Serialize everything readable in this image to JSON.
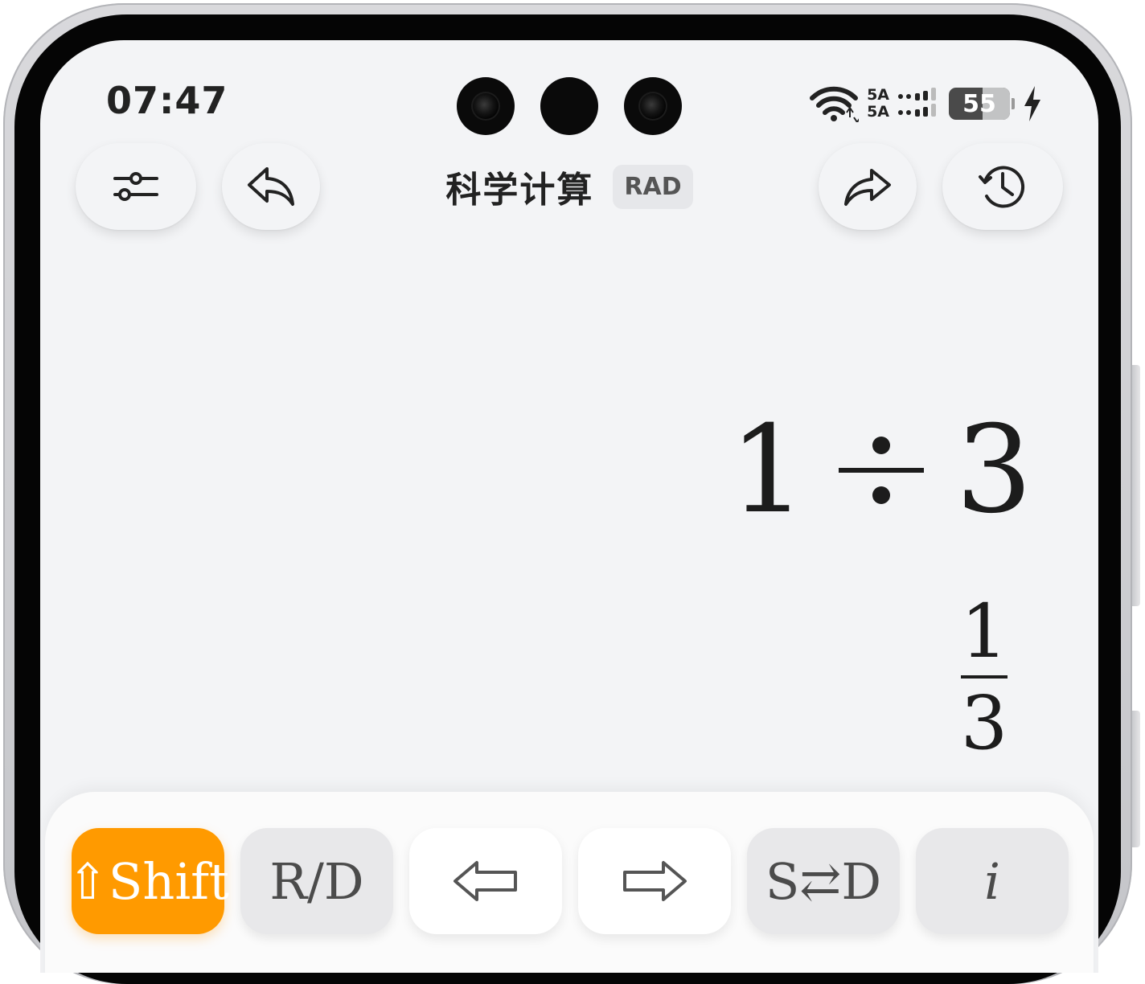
{
  "status_bar": {
    "time": "07:47",
    "network_top": "5A",
    "network_bottom": "5A",
    "battery": "55",
    "wifi_icon": "wifi-icon",
    "signal_icon": "signal-icon",
    "charging_icon": "lightning-icon"
  },
  "toolbar": {
    "title": "科学计算",
    "angle_mode": "RAD",
    "settings_icon": "sliders-icon",
    "undo_icon": "undo-icon",
    "redo_icon": "redo-icon",
    "history_icon": "history-clock-icon"
  },
  "display": {
    "expression": {
      "left": "1",
      "operator": "÷",
      "right": "3"
    },
    "result": {
      "numerator": "1",
      "denominator": "3"
    }
  },
  "keypad": {
    "keys": [
      {
        "label": "⇧Shift",
        "style": "active"
      },
      {
        "label": "R/D",
        "style": "grey"
      },
      {
        "label": "⇦",
        "style": "white"
      },
      {
        "label": "⇨",
        "style": "white"
      },
      {
        "label": "S⇄D",
        "style": "grey"
      },
      {
        "label": "i",
        "style": "grey"
      }
    ]
  },
  "colors": {
    "accent": "#ff9a00",
    "screen_bg": "#f3f4f6",
    "text": "#1c1c1c"
  }
}
